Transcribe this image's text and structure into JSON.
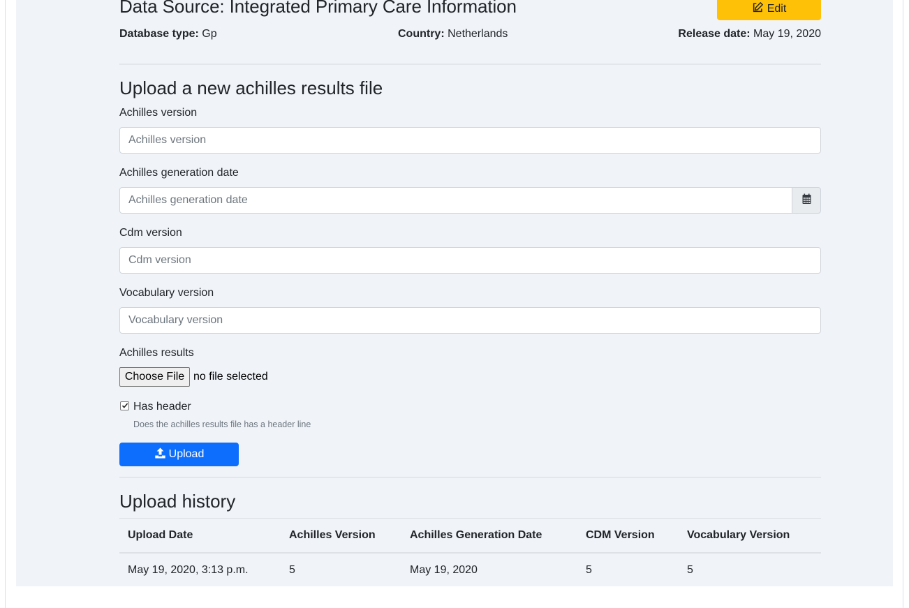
{
  "header": {
    "title": "Data Source: Integrated Primary Care Information",
    "edit_label": "Edit",
    "database_type_label": "Database type:",
    "database_type_value": "Gp",
    "country_label": "Country:",
    "country_value": "Netherlands",
    "release_date_label": "Release date:",
    "release_date_value": "May 19, 2020"
  },
  "upload_form": {
    "heading": "Upload a new achilles results file",
    "achilles_version": {
      "label": "Achilles version",
      "placeholder": "Achilles version",
      "value": ""
    },
    "achilles_generation_date": {
      "label": "Achilles generation date",
      "placeholder": "Achilles generation date",
      "value": ""
    },
    "cdm_version": {
      "label": "Cdm version",
      "placeholder": "Cdm version",
      "value": ""
    },
    "vocabulary_version": {
      "label": "Vocabulary version",
      "placeholder": "Vocabulary version",
      "value": ""
    },
    "achilles_results": {
      "label": "Achilles results",
      "choose_file_label": "Choose File",
      "file_status": "no file selected"
    },
    "has_header": {
      "label": "Has header",
      "checked": true,
      "help": "Does the achilles results file has a header line"
    },
    "upload_label": "Upload"
  },
  "history": {
    "heading": "Upload history",
    "columns": [
      "Upload Date",
      "Achilles Version",
      "Achilles Generation Date",
      "CDM Version",
      "Vocabulary Version"
    ],
    "rows": [
      [
        "May 19, 2020, 3:13 p.m.",
        "5",
        "May 19, 2020",
        "5",
        "5"
      ]
    ]
  },
  "colors": {
    "edit_button": "#ffc107",
    "upload_button": "#0d6efd",
    "panel_background": "#f0f4f9"
  },
  "icons": {
    "edit": "edit-icon",
    "calendar": "calendar-icon",
    "upload": "upload-icon",
    "checkbox": "check-icon"
  }
}
